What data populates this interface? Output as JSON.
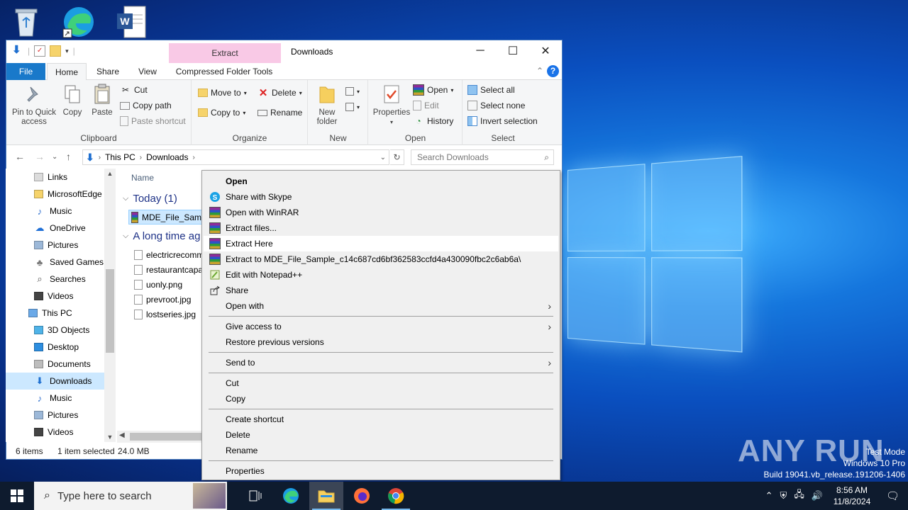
{
  "desktop": {
    "icons": [
      "recycle-bin",
      "microsoft-edge",
      "word-document"
    ],
    "watermark": "ANY RUN",
    "test_mode": [
      "Test Mode",
      "Windows 10 Pro",
      "Build 19041.vb_release.191206-1406"
    ]
  },
  "explorer": {
    "title": "Downloads",
    "context_tab": "Extract",
    "tabs": [
      "File",
      "Home",
      "Share",
      "View",
      "Compressed Folder Tools"
    ],
    "ribbon": {
      "clipboard": {
        "label": "Clipboard",
        "pin": "Pin to Quick access",
        "copy": "Copy",
        "paste": "Paste",
        "cut": "Cut",
        "copy_path": "Copy path",
        "paste_shortcut": "Paste shortcut"
      },
      "organize": {
        "label": "Organize",
        "move_to": "Move to",
        "copy_to": "Copy to",
        "delete": "Delete",
        "rename": "Rename"
      },
      "new": {
        "label": "New",
        "new_folder": "New folder"
      },
      "open": {
        "label": "Open",
        "properties": "Properties",
        "open": "Open",
        "edit": "Edit",
        "history": "History"
      },
      "select": {
        "label": "Select",
        "select_all": "Select all",
        "select_none": "Select none",
        "invert": "Invert selection"
      }
    },
    "address": {
      "crumbs": [
        "This PC",
        "Downloads"
      ],
      "search_placeholder": "Search Downloads"
    },
    "nav": [
      {
        "label": "Links"
      },
      {
        "label": "MicrosoftEdge"
      },
      {
        "label": "Music"
      },
      {
        "label": "OneDrive"
      },
      {
        "label": "Pictures"
      },
      {
        "label": "Saved Games"
      },
      {
        "label": "Searches"
      },
      {
        "label": "Videos"
      },
      {
        "label": "This PC"
      },
      {
        "label": "3D Objects"
      },
      {
        "label": "Desktop"
      },
      {
        "label": "Documents"
      },
      {
        "label": "Downloads"
      },
      {
        "label": "Music"
      },
      {
        "label": "Pictures"
      },
      {
        "label": "Videos"
      }
    ],
    "content": {
      "column_name": "Name",
      "group_today": "Today (1)",
      "group_long": "A long time ag",
      "today_files": [
        "MDE_File_Sam"
      ],
      "older_files": [
        "electricrecomm",
        "restaurantcapa",
        "uonly.png",
        "prevroot.jpg",
        "lostseries.jpg"
      ]
    },
    "status": {
      "items": "6 items",
      "selected": "1 item selected",
      "size": "24.0 MB"
    }
  },
  "context_menu": {
    "items": [
      {
        "label": "Open",
        "bold": true
      },
      {
        "label": "Share with Skype"
      },
      {
        "label": "Open with WinRAR"
      },
      {
        "label": "Extract files..."
      },
      {
        "label": "Extract Here"
      },
      {
        "label": "Extract to MDE_File_Sample_c14c687cd6bf362583ccfd4a430090fbc2c6ab6a\\"
      },
      {
        "label": "Edit with Notepad++"
      },
      {
        "label": "Share"
      },
      {
        "label": "Open with"
      },
      {
        "label": "Give access to"
      },
      {
        "label": "Restore previous versions"
      },
      {
        "label": "Send to"
      },
      {
        "label": "Cut"
      },
      {
        "label": "Copy"
      },
      {
        "label": "Create shortcut"
      },
      {
        "label": "Delete"
      },
      {
        "label": "Rename"
      },
      {
        "label": "Properties"
      }
    ]
  },
  "taskbar": {
    "search_placeholder": "Type here to search",
    "time": "8:56 AM",
    "date": "11/8/2024"
  },
  "colors": {
    "accent": "#1979ca",
    "selection": "#cce8ff",
    "taskbar": "#0e1b2e"
  }
}
